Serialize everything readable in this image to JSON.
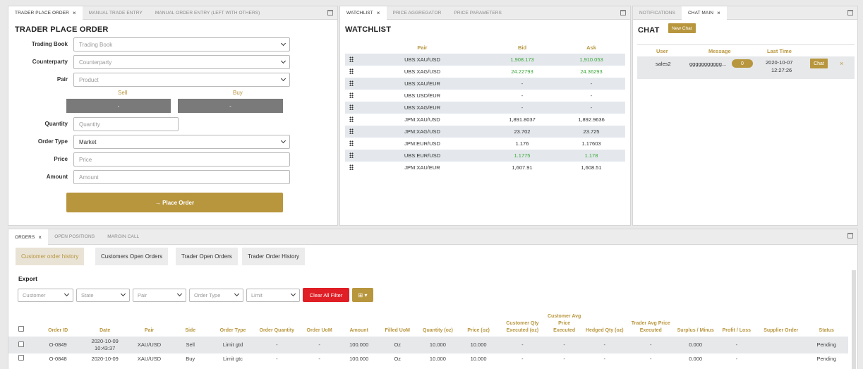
{
  "trader_panel": {
    "tabs": [
      "TRADER PLACE ORDER",
      "MANUAL TRADE ENTRY",
      "MANUAL ORDER ENTRY (LEFT WITH OTHERS)"
    ],
    "close_glyph": "×",
    "title": "TRADER PLACE ORDER",
    "fields": {
      "trading_book": {
        "label": "Trading Book",
        "placeholder": "Trading Book"
      },
      "counterparty": {
        "label": "Counterparty",
        "placeholder": "Counterparty"
      },
      "pair": {
        "label": "Pair",
        "placeholder": "Product"
      },
      "quantity": {
        "label": "Quantity",
        "placeholder": "Quantity"
      },
      "order_type": {
        "label": "Order Type",
        "value": "Market"
      },
      "price": {
        "label": "Price",
        "placeholder": "Price"
      },
      "amount": {
        "label": "Amount",
        "placeholder": "Amount"
      }
    },
    "sell_label": "Sell",
    "buy_label": "Buy",
    "sell_value": "-",
    "buy_value": "-",
    "place_order": "→ Place Order"
  },
  "watchlist": {
    "tabs": [
      "WATCHLIST",
      "PRICE AGGREGATOR",
      "PRICE PARAMETERS"
    ],
    "title": "WATCHLIST",
    "columns": [
      "Pair",
      "Bid",
      "Ask"
    ],
    "rows": [
      {
        "pair": "UBS:XAU/USD",
        "bid": "1,908.173",
        "ask": "1,910.053",
        "green": true
      },
      {
        "pair": "UBS:XAG/USD",
        "bid": "24.22793",
        "ask": "24.36293",
        "green": true
      },
      {
        "pair": "UBS:XAU/EUR",
        "bid": "-",
        "ask": "-",
        "green": false
      },
      {
        "pair": "UBS:USD/EUR",
        "bid": "-",
        "ask": "-",
        "green": false
      },
      {
        "pair": "UBS:XAG/EUR",
        "bid": "-",
        "ask": "-",
        "green": false
      },
      {
        "pair": "JPM:XAU/USD",
        "bid": "1,891.8037",
        "ask": "1,892.9636",
        "green": false
      },
      {
        "pair": "JPM:XAG/USD",
        "bid": "23.702",
        "ask": "23.725",
        "green": false
      },
      {
        "pair": "JPM:EUR/USD",
        "bid": "1.176",
        "ask": "1.17603",
        "green": false
      },
      {
        "pair": "UBS:EUR/USD",
        "bid": "1.1775",
        "ask": "1.178",
        "green": true
      },
      {
        "pair": "JPM:XAU/EUR",
        "bid": "1,607.91",
        "ask": "1,608.51",
        "green": false
      }
    ]
  },
  "chat_panel": {
    "tabs": [
      "NOTIFICATIONS",
      "CHAT MAIN"
    ],
    "title": "CHAT",
    "new_chat": "New Chat",
    "columns": [
      "User",
      "Message",
      "Last Time"
    ],
    "row": {
      "user": "sales2",
      "message": "ggggggggggg...",
      "badge": "0",
      "date": "2020-10-07",
      "time": "12:27:26",
      "chat_button": "Chat",
      "remove": "×"
    }
  },
  "orders": {
    "tabs": [
      "ORDERS",
      "OPEN POSITIONS",
      "MARGIN CALL"
    ],
    "subtabs": [
      "Customer order history",
      "Customers Open Orders",
      "Trader Open Orders",
      "Trader Order History"
    ],
    "export_label": "Export",
    "filters": [
      "Customer",
      "State",
      "Pair",
      "Order Type",
      "Limit"
    ],
    "clear_filter": "Clear All Filter",
    "grid_button": "⊞ ▾",
    "columns": [
      "Order ID",
      "Date",
      "Pair",
      "Side",
      "Order Type",
      "Order Quantity",
      "Order UoM",
      "Amount",
      "Filled UoM",
      "Quantity (oz)",
      "Price (oz)",
      "Customer Qty Executed (oz)",
      "Customer Avg Price Executed",
      "Hedged Qty (oz)",
      "Trader Avg Price Executed",
      "Surplus / Minus",
      "Profit / Loss",
      "Supplier Order",
      "Status"
    ],
    "rows": [
      [
        "O-0849",
        "2020-10-09 10:43:37",
        "XAU/USD",
        "Sell",
        "Limit gtd",
        "-",
        "-",
        "100.000",
        "Oz",
        "10.000",
        "10.000",
        "-",
        "-",
        "-",
        "-",
        "0.000",
        "-",
        "",
        "Pending"
      ],
      [
        "O-0848",
        "2020-10-09",
        "XAU/USD",
        "Buy",
        "Limit gtc",
        "-",
        "-",
        "100.000",
        "Oz",
        "10.000",
        "10.000",
        "-",
        "-",
        "-",
        "-",
        "0.000",
        "-",
        "",
        "Pending"
      ]
    ]
  },
  "colors": {
    "accent": "#b8963e",
    "green": "#3aa63a",
    "clear_filter": "#e01e26",
    "sell_buy": "#7a7a7a"
  }
}
